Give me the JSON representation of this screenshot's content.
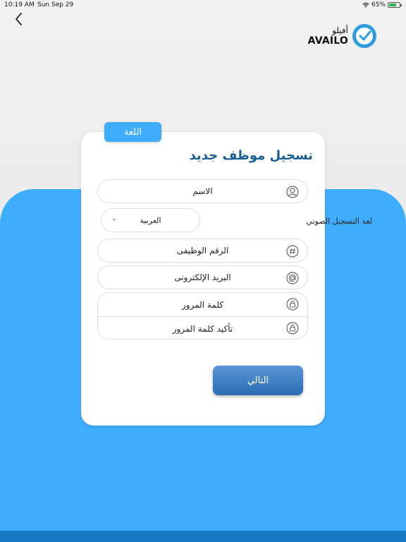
{
  "status_bar": {
    "time": "10:19 AM",
    "date": "Sun Sep 29",
    "battery": "65%"
  },
  "logo": {
    "arabic": "أفيلو",
    "english": "AVAILO"
  },
  "language_tab": "اللغة",
  "title": "تسجيل موظف جديد",
  "fields": {
    "name": "الاسم",
    "voice_label": "لغة التسجيل الصوتي",
    "voice_language": "العربية",
    "employee_id": "الرقم الوظيفى",
    "email": "البريد الإلكترونى",
    "password": "كلمة المرور",
    "confirm_password": "تأكيد كلمة المرور"
  },
  "next_button": "التالي",
  "colors": {
    "primary_blue": "#3eaefc",
    "title_blue": "#1a5e96",
    "button_blue": "#2a6cb2",
    "bottom_bar": "#1779c6"
  }
}
